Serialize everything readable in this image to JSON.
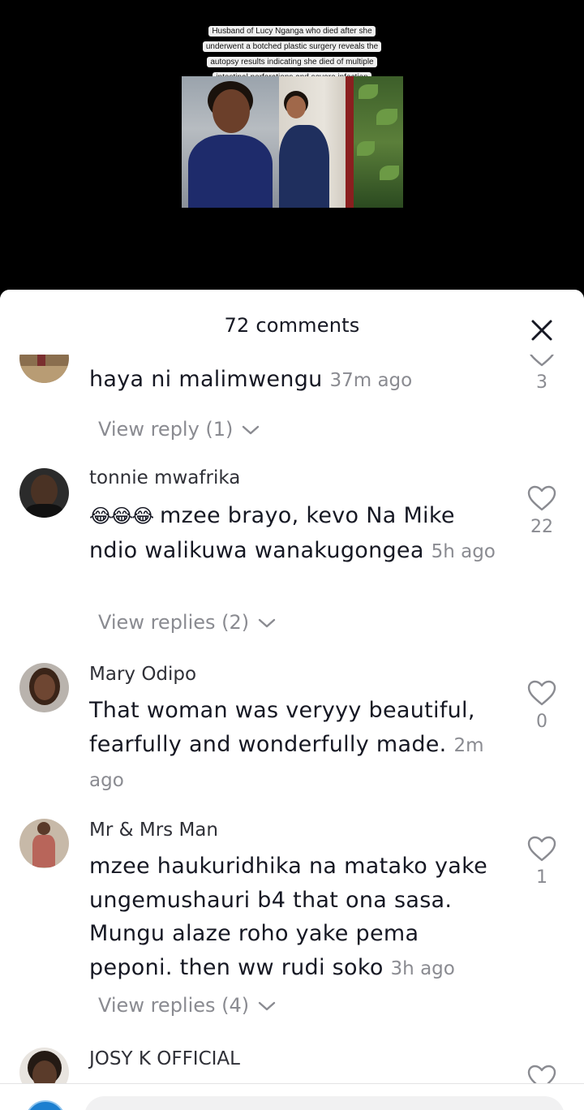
{
  "video": {
    "caption_lines": [
      "Husband of Lucy Nganga who died after she",
      "underwent a botched plastic surgery reveals the",
      "autopsy results indicating she died of multiple",
      "intestinal perforations and severe infection"
    ]
  },
  "sheet": {
    "title": "72 comments",
    "close_icon": "close-icon"
  },
  "comments": [
    {
      "username": "",
      "text": "haya ni malimwengu",
      "timestamp": "37m ago",
      "likes": "3",
      "view_replies": "View reply (1)"
    },
    {
      "username": "tonnie mwafrika",
      "emoji": "😂😂😂",
      "text": "mzee brayo, kevo Na Mike ndio walikuwa wanakugongea",
      "timestamp": "5h ago",
      "likes": "22",
      "view_replies": "View replies (2)"
    },
    {
      "username": "Mary Odipo",
      "text": "That woman was veryyy beautiful, fearfully and wonderfully made.",
      "timestamp": "2m ago",
      "likes": "0"
    },
    {
      "username": "Mr & Mrs Man",
      "text": "mzee haukuridhika na matako yake ungemushauri b4 that ona sasa. Mungu alaze roho yake pema peponi. then ww rudi soko",
      "timestamp": "3h ago",
      "likes": "1",
      "view_replies": "View replies (4)"
    },
    {
      "username": "JOSY K OFFICIAL"
    }
  ],
  "input": {
    "placeholder": ""
  },
  "colors": {
    "text_primary": "#161823",
    "text_secondary": "#8a8b91",
    "sheet_bg": "#ffffff",
    "video_bg": "#000000"
  }
}
